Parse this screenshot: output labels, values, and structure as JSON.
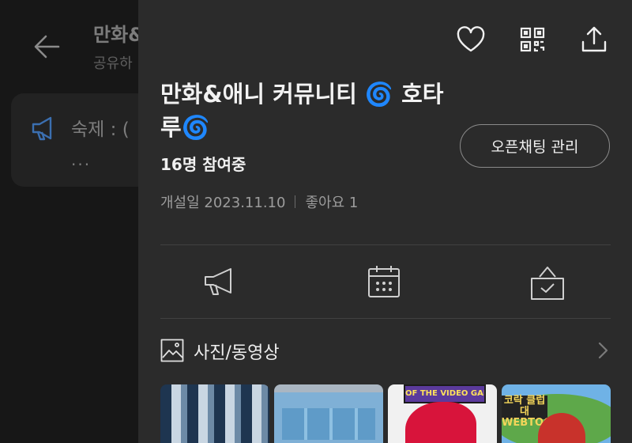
{
  "background": {
    "title": "만화&",
    "subtitle": "공유하",
    "notice_text": "숙제 : (",
    "notice_more": "..."
  },
  "drawer": {
    "title": "만화&애니 커뮤니티 🌀 호타루🌀",
    "members": "16명 참여중",
    "manage_button": "오픈채팅 관리",
    "created": "개설일 2023.11.10",
    "likes": "좋아요 1",
    "menu_icons": [
      "megaphone-icon",
      "calendar-icon",
      "vote-box-icon"
    ],
    "media": {
      "label": "사진/동영상",
      "thumb3_text": "OF THE VIDEO GAME",
      "thumb4_text": "코락 클럽대 WEBTOON"
    }
  },
  "colors": {
    "drawer_bg": "#2b2b2b",
    "background": "#171717",
    "notice_icon": "#3b6fb0",
    "text": "#f0f0f0"
  }
}
